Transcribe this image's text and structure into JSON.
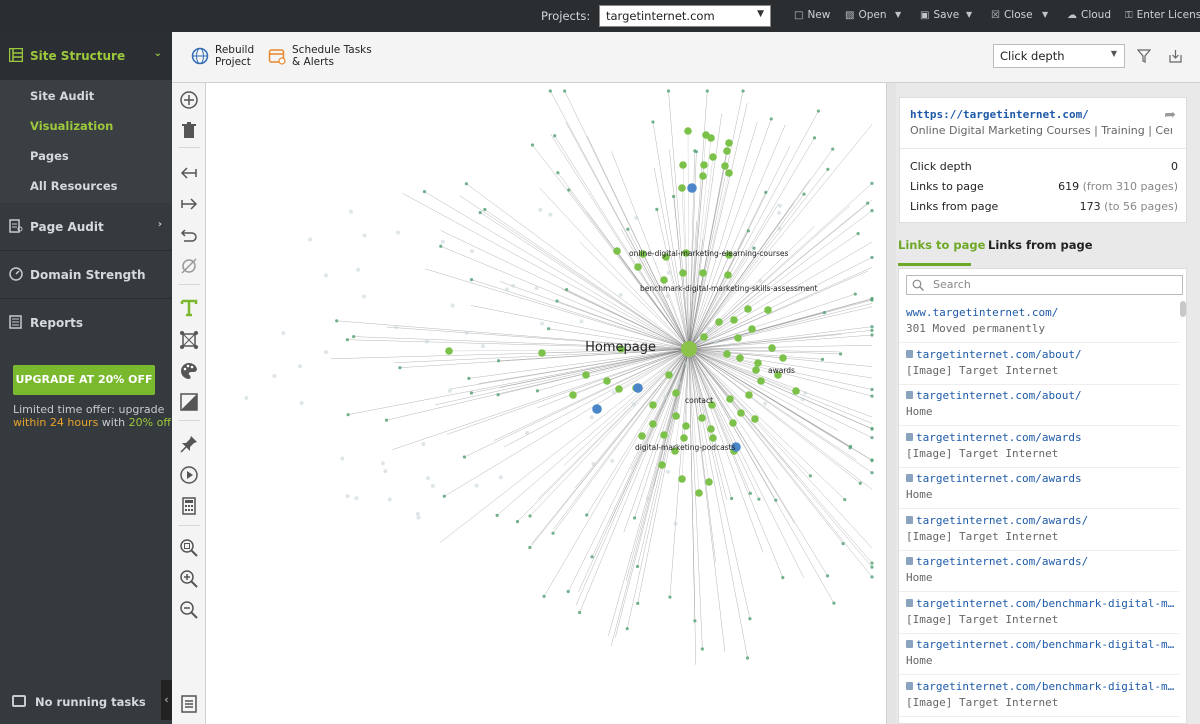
{
  "topbar": {
    "projects_label": "Projects:",
    "project_value": "targetinternet.com",
    "new_label": "New",
    "open_label": "Open",
    "save_label": "Save",
    "close_label": "Close",
    "cloud_label": "Cloud",
    "license_label": "Enter License"
  },
  "sidebar": {
    "site_structure": "Site Structure",
    "items": [
      "Site Audit",
      "Visualization",
      "Pages",
      "All Resources"
    ],
    "active_item": "Visualization",
    "page_audit": "Page Audit",
    "domain_strength": "Domain Strength",
    "reports": "Reports",
    "upgrade_button": "UPGRADE AT 20% OFF",
    "offer_line1": "Limited time offer: upgrade",
    "offer_within": "within",
    "offer_hours": "24 hours",
    "offer_with": "with",
    "offer_pct": "20% off",
    "status": "No running tasks"
  },
  "toolbar": {
    "rebuild_line1": "Rebuild",
    "rebuild_line2": "Project",
    "schedule_line1": "Schedule Tasks",
    "schedule_line2": "& Alerts",
    "view_select": "Click depth"
  },
  "graph": {
    "center_label": "Homepage",
    "labels": [
      "online-digital-marketing-elearning-courses",
      "benchmark-digital-marketing-skills-assessment",
      "awards",
      "contact",
      "digital-marketing-podcasts"
    ],
    "colors": {
      "edge": "#7a7a7a",
      "node_green": "#7cc24a",
      "node_teal": "#5aa57a",
      "node_blue": "#4a86c8",
      "node_root": "#8bc34a"
    }
  },
  "details": {
    "url": "https://targetinternet.com/",
    "title": "Online Digital Marketing Courses | Training | Certification",
    "click_depth_label": "Click depth",
    "click_depth_value": "0",
    "links_to_label": "Links to page",
    "links_to_value": "619",
    "links_to_sub": "(from 310 pages)",
    "links_from_label": "Links from page",
    "links_from_value": "173",
    "links_from_sub": "(to 56 pages)"
  },
  "tabs": {
    "links_to": "Links to page",
    "links_from": "Links from page",
    "active": "Links to page"
  },
  "list": {
    "search_placeholder": "Search",
    "items": [
      {
        "url": "www.targetinternet.com/",
        "text": "301 Moved permanently",
        "secure": false
      },
      {
        "url": "targetinternet.com/about/",
        "text": "[Image] Target Internet",
        "secure": true
      },
      {
        "url": "targetinternet.com/about/",
        "text": "Home",
        "secure": true
      },
      {
        "url": "targetinternet.com/awards",
        "text": "[Image] Target Internet",
        "secure": true
      },
      {
        "url": "targetinternet.com/awards",
        "text": "Home",
        "secure": true
      },
      {
        "url": "targetinternet.com/awards/",
        "text": "[Image] Target Internet",
        "secure": true
      },
      {
        "url": "targetinternet.com/awards/",
        "text": "Home",
        "secure": true
      },
      {
        "url": "targetinternet.com/benchmark-digital-marketing-skills-assessment",
        "text": "[Image] Target Internet",
        "secure": true
      },
      {
        "url": "targetinternet.com/benchmark-digital-marketing-skills-assessment",
        "text": "Home",
        "secure": true
      },
      {
        "url": "targetinternet.com/benchmark-digital-marketing-skills-assessment",
        "text": "[Image] Target Internet",
        "secure": true
      }
    ]
  }
}
